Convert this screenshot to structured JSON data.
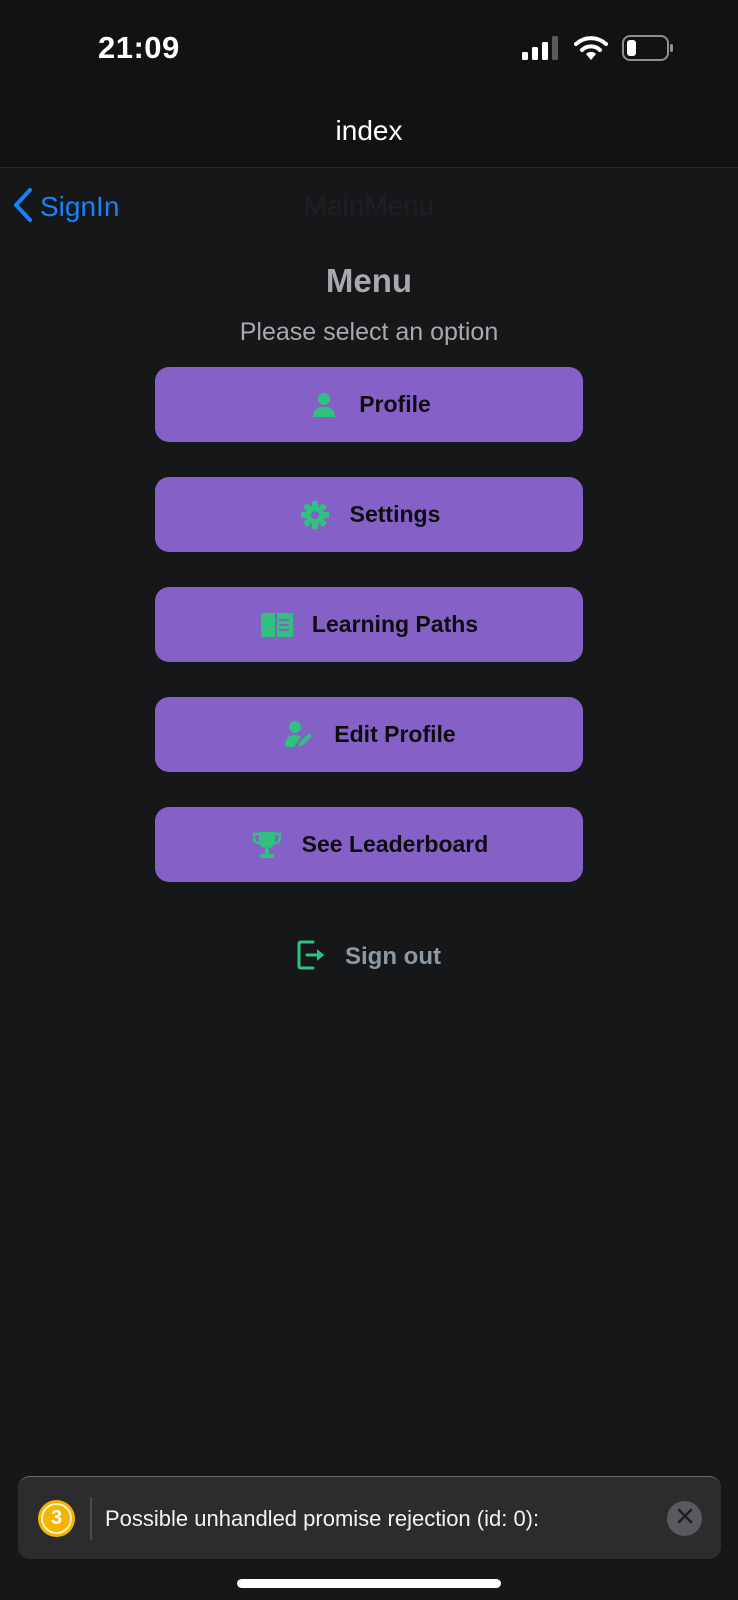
{
  "status_bar": {
    "time": "21:09"
  },
  "header": {
    "title": "index"
  },
  "nav": {
    "back_label": "SignIn",
    "title": "MainMenu"
  },
  "menu": {
    "title": "Menu",
    "subtitle": "Please select an option",
    "items": [
      {
        "label": "Profile",
        "icon": "person-icon"
      },
      {
        "label": "Settings",
        "icon": "gear-icon"
      },
      {
        "label": "Learning Paths",
        "icon": "book-icon"
      },
      {
        "label": "Edit Profile",
        "icon": "person-edit-icon"
      },
      {
        "label": "See Leaderboard",
        "icon": "trophy-icon"
      }
    ],
    "signout_label": "Sign out"
  },
  "toast": {
    "count": "3",
    "message": "Possible unhandled promise rejection (id: 0):"
  },
  "colors": {
    "accent": "#8561c7",
    "icon_green": "#2ec27e",
    "link_blue": "#1a82f7",
    "background": "#161719"
  }
}
